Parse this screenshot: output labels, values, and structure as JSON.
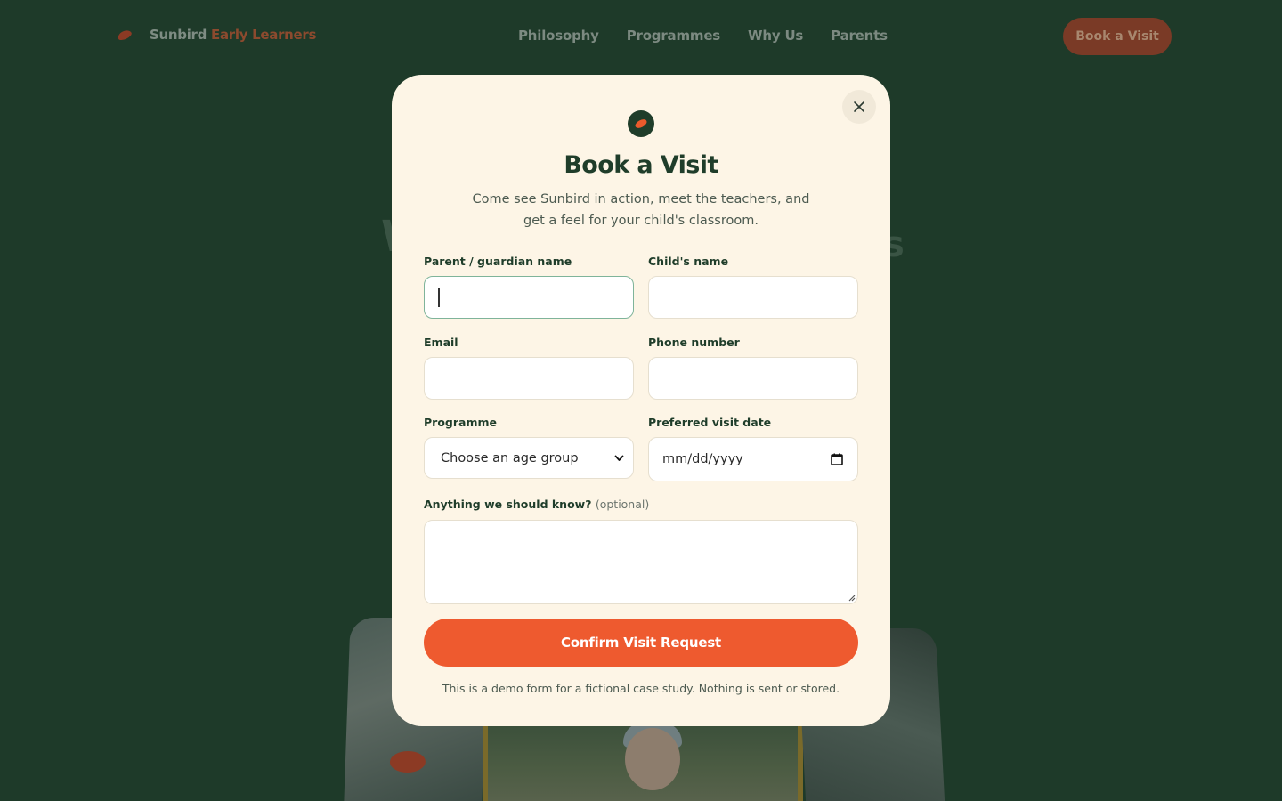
{
  "nav": {
    "brand_first": "Sunbird",
    "brand_accent": "Early Learners",
    "links": [
      "Philosophy",
      "Programmes",
      "Why Us",
      "Parents"
    ],
    "cta_label": "Book a Visit"
  },
  "hero": {
    "ghost_left": "W",
    "ghost_right": "s"
  },
  "modal": {
    "logo_icon": "leaf-icon",
    "close_icon": "close-icon",
    "title": "Book a Visit",
    "subtitle": "Come see Sunbird in action, meet the teachers, and get a feel for your child's classroom.",
    "fields": {
      "parent_name": {
        "label": "Parent / guardian name",
        "value": ""
      },
      "child_name": {
        "label": "Child's name",
        "value": ""
      },
      "email": {
        "label": "Email",
        "value": ""
      },
      "phone": {
        "label": "Phone number",
        "value": ""
      },
      "programme": {
        "label": "Programme",
        "selected": "Choose an age group"
      },
      "visit_date": {
        "label": "Preferred visit date",
        "placeholder": "mm/dd/yyyy"
      },
      "notes": {
        "label": "Anything we should know?",
        "optional": "(optional)",
        "value": ""
      }
    },
    "submit_label": "Confirm Visit Request",
    "disclaimer": "This is a demo form for a fictional case study. Nothing is sent or stored."
  },
  "colors": {
    "page_bg": "#1e3a29",
    "modal_bg": "#fdf5e6",
    "primary": "#ee5a2f",
    "heading": "#1f3d2a",
    "focus_ring": "#7fb49a"
  }
}
